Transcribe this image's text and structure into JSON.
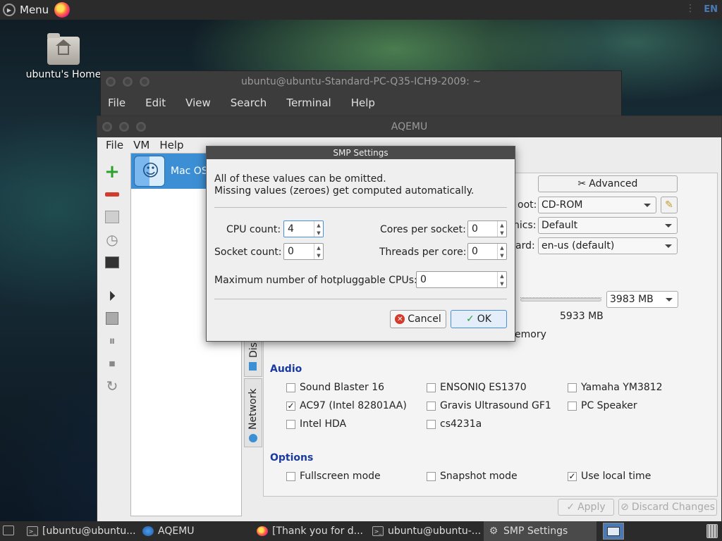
{
  "top_panel": {
    "menu_label": "Menu",
    "language": "EN"
  },
  "desktop": {
    "home_label": "ubuntu's Home"
  },
  "terminal": {
    "title": "ubuntu@ubuntu-Standard-PC-Q35-ICH9-2009: ~",
    "menu": [
      "File",
      "Edit",
      "View",
      "Search",
      "Terminal",
      "Help"
    ]
  },
  "aqemu": {
    "title": "AQEMU",
    "menu": {
      "file": "File",
      "vm": "VM",
      "help": "Help"
    },
    "vm_name": "Mac OS",
    "advanced_label": "Advanced",
    "boot_label": "oot:",
    "boot_value": "CD-ROM",
    "graphics_label": "nics:",
    "graphics_value": "Default",
    "keyboard_label": "ard:",
    "keyboard_value": "en-us (default)",
    "memory_value": "3983 MB",
    "memory_max": "5933 MB",
    "memory_label": "emory",
    "tab_disks": "Dis",
    "tab_network": "Network",
    "audio": {
      "title": "Audio",
      "items": [
        {
          "label": "Sound Blaster 16",
          "checked": false
        },
        {
          "label": "ENSONIQ ES1370",
          "checked": false
        },
        {
          "label": "Yamaha YM3812",
          "checked": false
        },
        {
          "label": "AC97 (Intel 82801AA)",
          "checked": true
        },
        {
          "label": "Gravis Ultrasound GF1",
          "checked": false
        },
        {
          "label": "PC Speaker",
          "checked": false
        },
        {
          "label": "Intel HDA",
          "checked": false
        },
        {
          "label": "cs4231a",
          "checked": false
        }
      ]
    },
    "options": {
      "title": "Options",
      "items": [
        {
          "label": "Fullscreen mode",
          "checked": false
        },
        {
          "label": "Snapshot mode",
          "checked": false
        },
        {
          "label": "Use local time",
          "checked": true
        }
      ]
    },
    "apply_label": "Apply",
    "discard_label": "Discard Changes"
  },
  "dialog": {
    "title": "SMP Settings",
    "text_line1": "All of these values can be omitted.",
    "text_line2": "Missing values (zeroes) get computed automatically.",
    "cpu_count_label": "CPU count:",
    "cpu_count_value": "4",
    "cores_label": "Cores per socket:",
    "cores_value": "0",
    "socket_label": "Socket count:",
    "socket_value": "0",
    "threads_label": "Threads per core:",
    "threads_value": "0",
    "max_label": "Maximum number of hotpluggable CPUs:",
    "max_value": "0",
    "cancel_label": "Cancel",
    "ok_label": "OK"
  },
  "taskbar": {
    "tasks": [
      "[ubuntu@ubuntu...",
      "AQEMU",
      "[Thank you for d...",
      "ubuntu@ubuntu-...",
      "SMP Settings"
    ]
  }
}
